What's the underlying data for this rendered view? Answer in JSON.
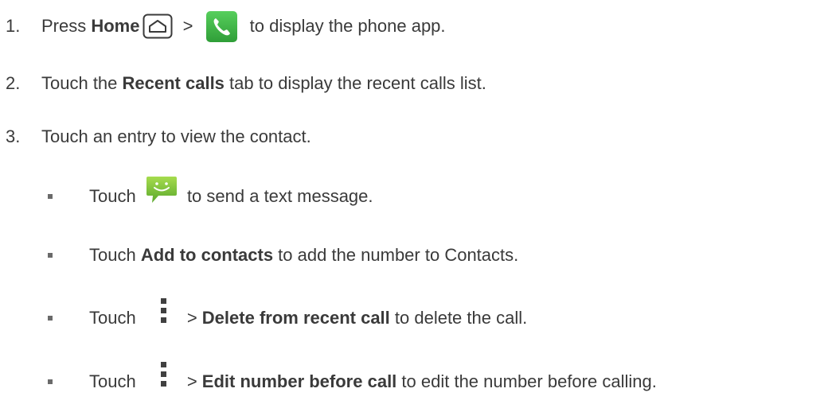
{
  "colors": {
    "text": "#3a3a3a",
    "phone_green": "#3fb846",
    "message_green": "#7cc242"
  },
  "steps": [
    {
      "num": "1.",
      "t1": "Press ",
      "b1": "Home",
      "t2": " > ",
      "t3": " to display the phone app.",
      "icons": [
        "home-key-icon",
        "phone-app-icon"
      ]
    },
    {
      "num": "2.",
      "t1": "Touch the ",
      "b1": "Recent calls",
      "t2": " tab to display the recent calls list."
    },
    {
      "num": "3.",
      "t1": "Touch an entry to view the contact."
    }
  ],
  "bullets": [
    {
      "t1": "Touch ",
      "t2": " to send a text message.",
      "icon": "message-icon"
    },
    {
      "t1": "Touch ",
      "b1": "Add to contacts",
      "t2": " to add the number to Contacts."
    },
    {
      "t1": "Touch ",
      "t2": "> ",
      "b1": "Delete from recent call",
      "t3": " to delete the call.",
      "icon": "menu-icon"
    },
    {
      "t1": "Touch ",
      "t2": "> ",
      "b1": "Edit number before call",
      "t3": " to edit the number before calling.",
      "icon": "menu-icon"
    }
  ]
}
